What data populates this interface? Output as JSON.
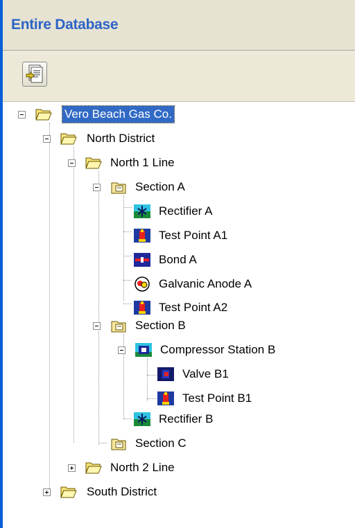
{
  "panel": {
    "title": "Entire Database"
  },
  "toolbar": {
    "button_icon": "report-icon"
  },
  "tree": {
    "root": "Vero Beach Gas Co.",
    "north_district": "North District",
    "north_1_line": "North 1 Line",
    "section_a": "Section A",
    "rectifier_a": "Rectifier A",
    "test_point_a1": "Test Point A1",
    "bond_a": "Bond A",
    "galvanic_anode_a": "Galvanic Anode A",
    "test_point_a2": "Test Point A2",
    "section_b": "Section B",
    "compressor_station_b": "Compressor Station B",
    "valve_b1": "Valve B1",
    "test_point_b1": "Test Point B1",
    "rectifier_b": "Rectifier B",
    "section_c": "Section C",
    "north_2_line": "North 2 Line",
    "south_district": "South District"
  },
  "colors": {
    "selection": "#316ac5",
    "title": "#2d64c8",
    "toolbar_bg": "#ece9d8"
  }
}
